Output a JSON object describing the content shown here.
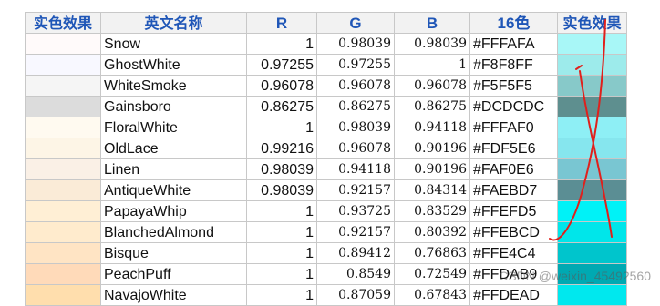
{
  "headers": [
    "实色效果",
    "英文名称",
    "R",
    "G",
    "B",
    "16色",
    "实色效果"
  ],
  "rows": [
    {
      "name": "Snow",
      "r": "1",
      "g": "0.98039",
      "b": "0.98039",
      "hex": "#FFFAFA",
      "swatch": "#FFFAFA",
      "tone": "#A8F7F7"
    },
    {
      "name": "GhostWhite",
      "r": "0.97255",
      "g": "0.97255",
      "b": "1",
      "hex": "#F8F8FF",
      "swatch": "#F8F8FF",
      "tone": "#9DEBEB"
    },
    {
      "name": "WhiteSmoke",
      "r": "0.96078",
      "g": "0.96078",
      "b": "0.96078",
      "hex": "#F5F5F5",
      "swatch": "#F5F5F5",
      "tone": "#87C9C9"
    },
    {
      "name": "Gainsboro",
      "r": "0.86275",
      "g": "0.86275",
      "b": "0.86275",
      "hex": "#DCDCDC",
      "swatch": "#DCDCDC",
      "tone": "#5E8F8F"
    },
    {
      "name": "FloralWhite",
      "r": "1",
      "g": "0.98039",
      "b": "0.94118",
      "hex": "#FFFAF0",
      "swatch": "#FFFAF0",
      "tone": "#8EEFF5"
    },
    {
      "name": "OldLace",
      "r": "0.99216",
      "g": "0.96078",
      "b": "0.90196",
      "hex": "#FDF5E6",
      "swatch": "#FDF5E6",
      "tone": "#86E6EE"
    },
    {
      "name": "Linen",
      "r": "0.98039",
      "g": "0.94118",
      "b": "0.90196",
      "hex": "#FAF0E6",
      "swatch": "#FAF0E6",
      "tone": "#79C6D2"
    },
    {
      "name": "AntiqueWhite",
      "r": "0.98039",
      "g": "0.92157",
      "b": "0.84314",
      "hex": "#FAEBD7",
      "swatch": "#FAEBD7",
      "tone": "#5B8E94"
    },
    {
      "name": "PapayaWhip",
      "r": "1",
      "g": "0.93725",
      "b": "0.83529",
      "hex": "#FFEFD5",
      "swatch": "#FFEFD5",
      "tone": "#00F2F7"
    },
    {
      "name": "BlanchedAlmond",
      "r": "1",
      "g": "0.92157",
      "b": "0.80392",
      "hex": "#FFEBCD",
      "swatch": "#FFEBCD",
      "tone": "#00E6EA"
    },
    {
      "name": "Bisque",
      "r": "1",
      "g": "0.89412",
      "b": "0.76863",
      "hex": "#FFE4C4",
      "swatch": "#FFE4C4",
      "tone": "#00C5CC"
    },
    {
      "name": "PeachPuff",
      "r": "1",
      "g": "0.8549",
      "b": "0.72549",
      "hex": "#FFDAB9",
      "swatch": "#FFDAB9",
      "tone": "#00A9B2"
    },
    {
      "name": "NavajoWhite",
      "r": "1",
      "g": "0.87059",
      "b": "0.67843",
      "hex": "#FFDEAD",
      "swatch": "#FFDEAD",
      "tone": "#00E8EE"
    }
  ],
  "watermark": "CSDN @weixin_45492560",
  "colors": {
    "header_text": "#1F56B7",
    "header_bg": "#F2F2F2",
    "grid_line": "#C8C8C8",
    "ink": "#E0201C"
  }
}
